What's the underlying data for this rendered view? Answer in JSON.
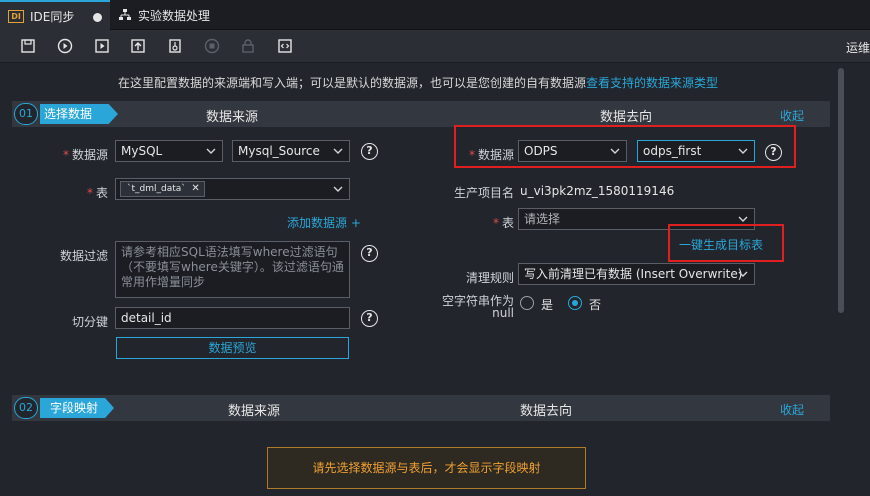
{
  "tabs": [
    {
      "badge": "DI",
      "label": "IDE同步"
    },
    {
      "label": "实验数据处理",
      "icon": "sitemap-icon"
    }
  ],
  "toolbar": {
    "icons": [
      "save-icon",
      "run-icon",
      "run-panel-icon",
      "upload-icon",
      "submit-icon",
      "stop-icon",
      "lock-icon",
      "code-icon"
    ],
    "right_label": "运维"
  },
  "notice": {
    "text": "在这里配置数据的来源端和写入端；可以是默认的数据源，也可以是您创建的自有数据源",
    "link": "查看支持的数据来源类型"
  },
  "section1": {
    "step_num": "01",
    "step_label": "选择数据源",
    "source_title": "数据来源",
    "target_title": "数据去向",
    "collapse": "收起"
  },
  "source": {
    "datasource_label": "数据源",
    "datasource_type": "MySQL",
    "datasource_name": "Mysql_Source",
    "table_label": "表",
    "table_tag": "`t_dml_data`",
    "add_datasource": "添加数据源 +",
    "filter_label": "数据过滤",
    "filter_placeholder": "请参考相应SQL语法填写where过滤语句（不要填写where关键字）。该过滤语句通常用作增量同步",
    "split_label": "切分键",
    "split_value": "detail_id",
    "preview_button": "数据预览"
  },
  "target": {
    "datasource_label": "数据源",
    "datasource_type": "ODPS",
    "datasource_name": "odps_first",
    "project_label": "生产项目名",
    "project_value": "u_vi3pk2mz_1580119146",
    "table_label": "表",
    "table_placeholder": "请选择",
    "generate_table": "一键生成目标表",
    "clean_label": "清理规则",
    "clean_value": "写入前清理已有数据 (Insert Overwrite)",
    "null_label_1": "空字符串作为",
    "null_label_2": "null",
    "radio_yes": "是",
    "radio_no": "否"
  },
  "section2": {
    "step_num": "02",
    "step_label": "字段映射",
    "source_title": "数据来源",
    "target_title": "数据去向",
    "collapse": "收起"
  },
  "warning": "请先选择数据源与表后，才会显示字段映射",
  "colors": {
    "accent": "#2aa7d8",
    "highlight": "#e02020",
    "warning": "#f0a030"
  }
}
